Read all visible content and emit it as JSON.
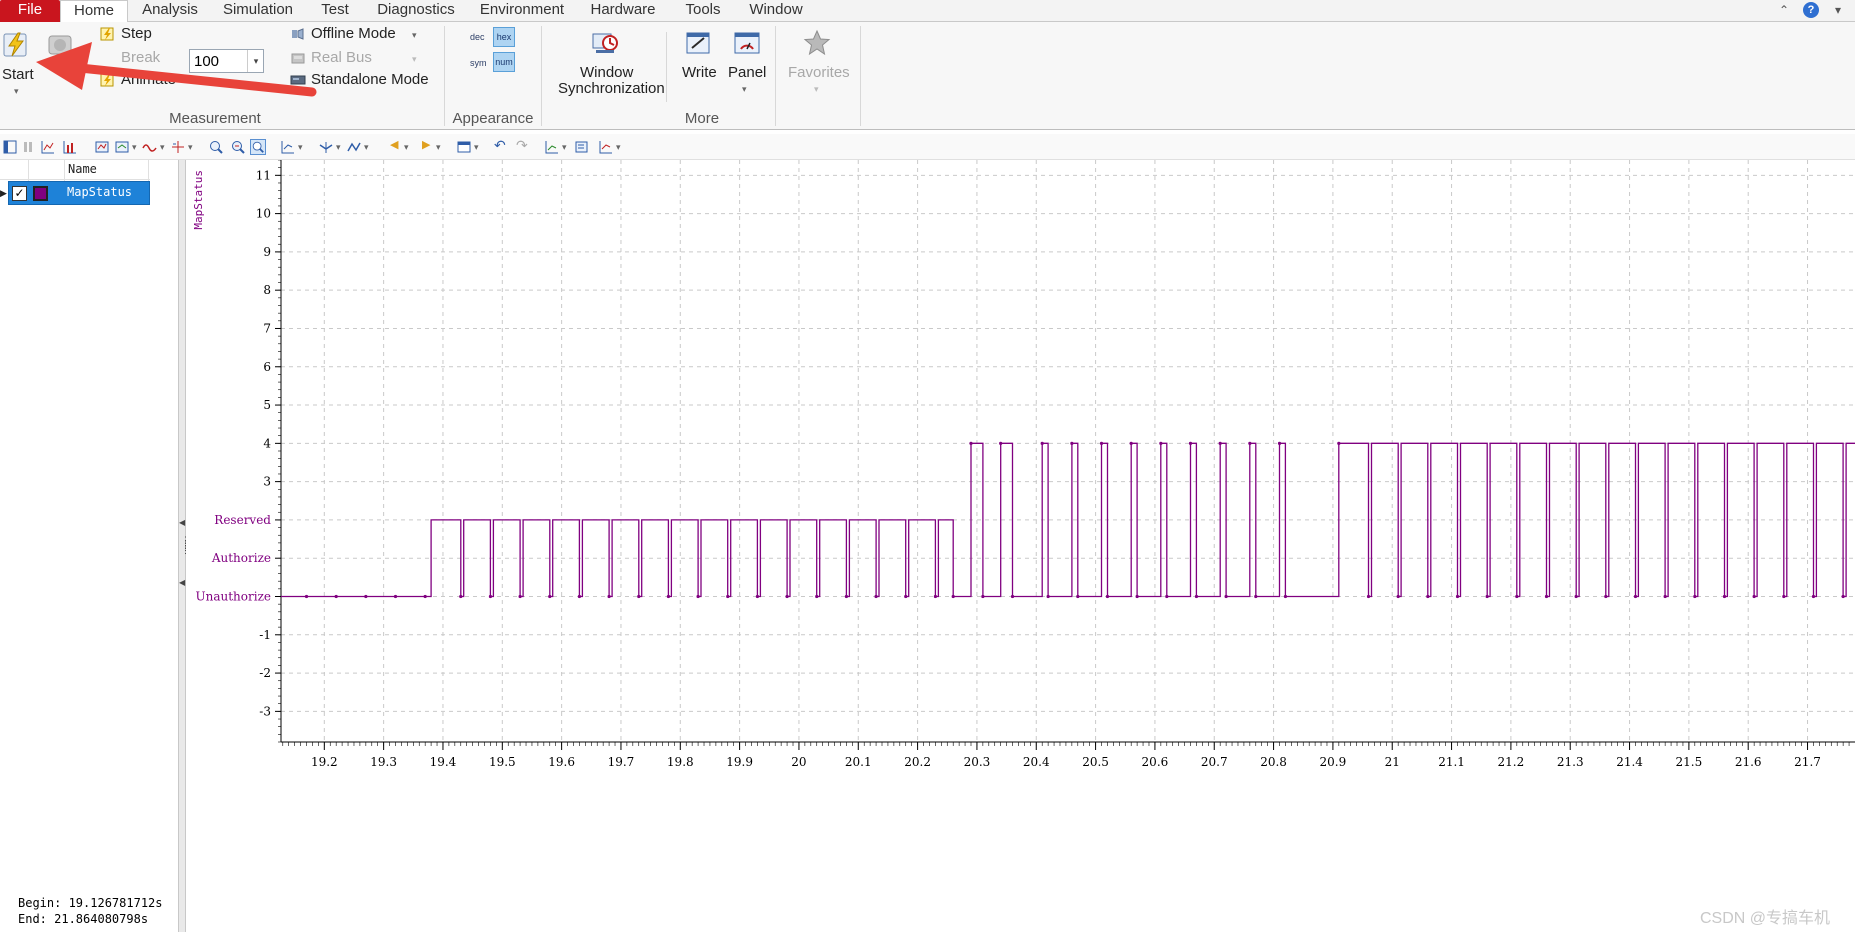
{
  "menubar": {
    "tabs": [
      {
        "label": "File"
      },
      {
        "label": "Home"
      },
      {
        "label": "Analysis"
      },
      {
        "label": "Simulation"
      },
      {
        "label": "Test"
      },
      {
        "label": "Diagnostics"
      },
      {
        "label": "Environment"
      },
      {
        "label": "Hardware"
      },
      {
        "label": "Tools"
      },
      {
        "label": "Window"
      }
    ],
    "active_tab": "Home"
  },
  "ribbon": {
    "measurement": {
      "start_label": "Start",
      "break_label": "Break",
      "step_label": "Step",
      "animate_label": "Animate",
      "step_value": "100",
      "offline_mode_label": "Offline Mode",
      "real_bus_label": "Real Bus",
      "standalone_mode_label": "Standalone Mode",
      "group_label": "Measurement"
    },
    "appearance": {
      "dec_label": "dec",
      "hex_label": "hex",
      "sym_label": "sym",
      "num_label": "num",
      "group_label": "Appearance"
    },
    "more": {
      "window_sync_label_1": "Window",
      "window_sync_label_2": "Synchronization",
      "write_label": "Write",
      "panel_label": "Panel",
      "group_label": "More"
    },
    "favorites_label": "Favorites"
  },
  "signal_list": {
    "header_name": "Name",
    "signals": [
      {
        "name": "MapStatus",
        "color": "#800080",
        "checked": true
      }
    ]
  },
  "measurement_info": {
    "begin": "Begin: 19.126781712s",
    "end": "End:  21.864080798s"
  },
  "watermark": "CSDN @专搞车机",
  "chart_data": {
    "type": "line",
    "series": [
      {
        "name": "MapStatus",
        "color": "#800080",
        "step": true,
        "points": [
          [
            19.127,
            0
          ],
          [
            19.38,
            0
          ],
          [
            19.38,
            2
          ],
          [
            19.43,
            2
          ],
          [
            19.43,
            0
          ],
          [
            19.435,
            0
          ],
          [
            19.435,
            2
          ],
          [
            19.48,
            2
          ],
          [
            19.48,
            0
          ],
          [
            19.485,
            0
          ],
          [
            19.485,
            2
          ],
          [
            19.53,
            2
          ],
          [
            19.53,
            0
          ],
          [
            19.535,
            0
          ],
          [
            19.535,
            2
          ],
          [
            19.58,
            2
          ],
          [
            19.58,
            0
          ],
          [
            19.585,
            0
          ],
          [
            19.585,
            2
          ],
          [
            19.63,
            2
          ],
          [
            19.63,
            0
          ],
          [
            19.635,
            0
          ],
          [
            19.635,
            2
          ],
          [
            19.68,
            2
          ],
          [
            19.68,
            0
          ],
          [
            19.685,
            0
          ],
          [
            19.685,
            2
          ],
          [
            19.73,
            2
          ],
          [
            19.73,
            0
          ],
          [
            19.735,
            0
          ],
          [
            19.735,
            2
          ],
          [
            19.78,
            2
          ],
          [
            19.78,
            0
          ],
          [
            19.785,
            0
          ],
          [
            19.785,
            2
          ],
          [
            19.83,
            2
          ],
          [
            19.83,
            0
          ],
          [
            19.835,
            0
          ],
          [
            19.835,
            2
          ],
          [
            19.88,
            2
          ],
          [
            19.88,
            0
          ],
          [
            19.885,
            0
          ],
          [
            19.885,
            2
          ],
          [
            19.93,
            2
          ],
          [
            19.93,
            0
          ],
          [
            19.935,
            0
          ],
          [
            19.935,
            2
          ],
          [
            19.98,
            2
          ],
          [
            19.98,
            0
          ],
          [
            19.985,
            0
          ],
          [
            19.985,
            2
          ],
          [
            20.03,
            2
          ],
          [
            20.03,
            0
          ],
          [
            20.035,
            0
          ],
          [
            20.035,
            2
          ],
          [
            20.08,
            2
          ],
          [
            20.08,
            0
          ],
          [
            20.085,
            0
          ],
          [
            20.085,
            2
          ],
          [
            20.13,
            2
          ],
          [
            20.13,
            0
          ],
          [
            20.135,
            0
          ],
          [
            20.135,
            2
          ],
          [
            20.18,
            2
          ],
          [
            20.18,
            0
          ],
          [
            20.185,
            0
          ],
          [
            20.185,
            2
          ],
          [
            20.23,
            2
          ],
          [
            20.23,
            0
          ],
          [
            20.235,
            0
          ],
          [
            20.235,
            2
          ],
          [
            20.26,
            2
          ],
          [
            20.26,
            0
          ],
          [
            20.29,
            0
          ],
          [
            20.29,
            4
          ],
          [
            20.31,
            4
          ],
          [
            20.31,
            0
          ],
          [
            20.34,
            0
          ],
          [
            20.34,
            4
          ],
          [
            20.36,
            4
          ],
          [
            20.36,
            0
          ],
          [
            20.41,
            0
          ],
          [
            20.41,
            4
          ],
          [
            20.42,
            4
          ],
          [
            20.42,
            0
          ],
          [
            20.46,
            0
          ],
          [
            20.46,
            4
          ],
          [
            20.47,
            4
          ],
          [
            20.47,
            0
          ],
          [
            20.51,
            0
          ],
          [
            20.51,
            4
          ],
          [
            20.52,
            4
          ],
          [
            20.52,
            0
          ],
          [
            20.56,
            0
          ],
          [
            20.56,
            4
          ],
          [
            20.57,
            4
          ],
          [
            20.57,
            0
          ],
          [
            20.61,
            0
          ],
          [
            20.61,
            4
          ],
          [
            20.62,
            4
          ],
          [
            20.62,
            0
          ],
          [
            20.66,
            0
          ],
          [
            20.66,
            4
          ],
          [
            20.67,
            4
          ],
          [
            20.67,
            0
          ],
          [
            20.71,
            0
          ],
          [
            20.71,
            4
          ],
          [
            20.72,
            4
          ],
          [
            20.72,
            0
          ],
          [
            20.76,
            0
          ],
          [
            20.76,
            4
          ],
          [
            20.77,
            4
          ],
          [
            20.77,
            0
          ],
          [
            20.81,
            0
          ],
          [
            20.81,
            4
          ],
          [
            20.82,
            4
          ],
          [
            20.82,
            0
          ],
          [
            20.91,
            0
          ],
          [
            20.91,
            4
          ],
          [
            20.96,
            4
          ],
          [
            20.96,
            0
          ],
          [
            20.965,
            0
          ],
          [
            20.965,
            4
          ],
          [
            21.01,
            4
          ],
          [
            21.01,
            0
          ],
          [
            21.015,
            0
          ],
          [
            21.015,
            4
          ],
          [
            21.06,
            4
          ],
          [
            21.06,
            0
          ],
          [
            21.065,
            0
          ],
          [
            21.065,
            4
          ],
          [
            21.11,
            4
          ],
          [
            21.11,
            0
          ],
          [
            21.115,
            0
          ],
          [
            21.115,
            4
          ],
          [
            21.16,
            4
          ],
          [
            21.16,
            0
          ],
          [
            21.165,
            0
          ],
          [
            21.165,
            4
          ],
          [
            21.21,
            4
          ],
          [
            21.21,
            0
          ],
          [
            21.215,
            0
          ],
          [
            21.215,
            4
          ],
          [
            21.26,
            4
          ],
          [
            21.26,
            0
          ],
          [
            21.265,
            0
          ],
          [
            21.265,
            4
          ],
          [
            21.31,
            4
          ],
          [
            21.31,
            0
          ],
          [
            21.315,
            0
          ],
          [
            21.315,
            4
          ],
          [
            21.36,
            4
          ],
          [
            21.36,
            0
          ],
          [
            21.365,
            0
          ],
          [
            21.365,
            4
          ],
          [
            21.41,
            4
          ],
          [
            21.41,
            0
          ],
          [
            21.415,
            0
          ],
          [
            21.415,
            4
          ],
          [
            21.46,
            4
          ],
          [
            21.46,
            0
          ],
          [
            21.465,
            0
          ],
          [
            21.465,
            4
          ],
          [
            21.51,
            4
          ],
          [
            21.51,
            0
          ],
          [
            21.515,
            0
          ],
          [
            21.515,
            4
          ],
          [
            21.56,
            4
          ],
          [
            21.56,
            0
          ],
          [
            21.565,
            0
          ],
          [
            21.565,
            4
          ],
          [
            21.61,
            4
          ],
          [
            21.61,
            0
          ],
          [
            21.615,
            0
          ],
          [
            21.615,
            4
          ],
          [
            21.66,
            4
          ],
          [
            21.66,
            0
          ],
          [
            21.665,
            0
          ],
          [
            21.665,
            4
          ],
          [
            21.71,
            4
          ],
          [
            21.71,
            0
          ],
          [
            21.715,
            0
          ],
          [
            21.715,
            4
          ],
          [
            21.76,
            4
          ],
          [
            21.76,
            0
          ],
          [
            21.765,
            0
          ],
          [
            21.765,
            4
          ],
          [
            21.8,
            4
          ]
        ],
        "markers_x": [
          19.17,
          19.22,
          19.27,
          19.32,
          19.37,
          19.43,
          19.48,
          19.53,
          19.58,
          19.63,
          19.68,
          19.73,
          19.78,
          19.83,
          19.88,
          19.93,
          19.98,
          20.03,
          20.08,
          20.13,
          20.18,
          20.23,
          20.26,
          20.29,
          20.31,
          20.34,
          20.36,
          20.41,
          20.42,
          20.46,
          20.47,
          20.51,
          20.52,
          20.56,
          20.57,
          20.61,
          20.62,
          20.66,
          20.67,
          20.71,
          20.72,
          20.76,
          20.77,
          20.81,
          20.82,
          20.91,
          20.96,
          21.01,
          21.06,
          21.11,
          21.16,
          21.21,
          21.26,
          21.31,
          21.36,
          21.41,
          21.46,
          21.51,
          21.56,
          21.61,
          21.66,
          21.71,
          21.76
        ]
      }
    ],
    "ylabel": "MapStatus",
    "xlim": [
      19.127,
      21.78
    ],
    "ylim": [
      -3.8,
      11.4
    ],
    "y_ticks": [
      {
        "v": 11,
        "label": "11"
      },
      {
        "v": 10,
        "label": "10"
      },
      {
        "v": 9,
        "label": "9"
      },
      {
        "v": 8,
        "label": "8"
      },
      {
        "v": 7,
        "label": "7"
      },
      {
        "v": 6,
        "label": "6"
      },
      {
        "v": 5,
        "label": "5"
      },
      {
        "v": 4,
        "label": "4"
      },
      {
        "v": 3,
        "label": "3"
      },
      {
        "v": 2,
        "label": "Reserved",
        "enum": true
      },
      {
        "v": 1,
        "label": "Authorize",
        "enum": true
      },
      {
        "v": 0,
        "label": "Unauthorize",
        "enum": true
      },
      {
        "v": -1,
        "label": "-1"
      },
      {
        "v": -2,
        "label": "-2"
      },
      {
        "v": -3,
        "label": "-3"
      }
    ],
    "x_ticks": [
      {
        "v": 19.2,
        "label": "19.2"
      },
      {
        "v": 19.3,
        "label": "19.3"
      },
      {
        "v": 19.4,
        "label": "19.4"
      },
      {
        "v": 19.5,
        "label": "19.5"
      },
      {
        "v": 19.6,
        "label": "19.6"
      },
      {
        "v": 19.7,
        "label": "19.7"
      },
      {
        "v": 19.8,
        "label": "19.8"
      },
      {
        "v": 19.9,
        "label": "19.9"
      },
      {
        "v": 20.0,
        "label": "20"
      },
      {
        "v": 20.1,
        "label": "20.1"
      },
      {
        "v": 20.2,
        "label": "20.2"
      },
      {
        "v": 20.3,
        "label": "20.3"
      },
      {
        "v": 20.4,
        "label": "20.4"
      },
      {
        "v": 20.5,
        "label": "20.5"
      },
      {
        "v": 20.6,
        "label": "20.6"
      },
      {
        "v": 20.7,
        "label": "20.7"
      },
      {
        "v": 20.8,
        "label": "20.8"
      },
      {
        "v": 20.9,
        "label": "20.9"
      },
      {
        "v": 21.0,
        "label": "21"
      },
      {
        "v": 21.1,
        "label": "21.1"
      },
      {
        "v": 21.2,
        "label": "21.2"
      },
      {
        "v": 21.3,
        "label": "21.3"
      },
      {
        "v": 21.4,
        "label": "21.4"
      },
      {
        "v": 21.5,
        "label": "21.5"
      },
      {
        "v": 21.6,
        "label": "21.6"
      },
      {
        "v": 21.7,
        "label": "21.7"
      }
    ],
    "grid": true
  }
}
